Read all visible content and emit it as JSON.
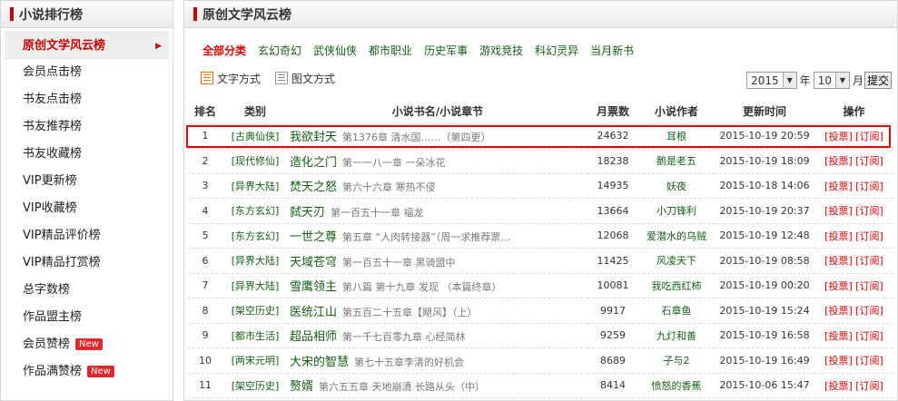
{
  "sidebar": {
    "title": "小说排行榜",
    "items": [
      {
        "label": "原创文学风云榜",
        "active": true
      },
      {
        "label": "会员点击榜"
      },
      {
        "label": "书友点击榜"
      },
      {
        "label": "书友推荐榜"
      },
      {
        "label": "书友收藏榜"
      },
      {
        "label": "VIP更新榜"
      },
      {
        "label": "VIP收藏榜"
      },
      {
        "label": "VIP精品评价榜"
      },
      {
        "label": "VIP精品打赏榜"
      },
      {
        "label": "总字数榜"
      },
      {
        "label": "作品盟主榜"
      },
      {
        "label": "会员赞榜",
        "badge": "New"
      },
      {
        "label": "作品满赞榜",
        "badge": "New"
      }
    ]
  },
  "main": {
    "title": "原创文学风云榜",
    "categories": [
      "全部分类",
      "玄幻奇幻",
      "武侠仙侠",
      "都市职业",
      "历史军事",
      "游戏竞技",
      "科幻灵异",
      "当月新书"
    ],
    "mode_text": "文字方式",
    "mode_image": "图文方式",
    "year": "2015",
    "year_unit": "年",
    "month": "10",
    "month_unit": "月",
    "submit": "提交",
    "headers": [
      "排名",
      "类别",
      "小说书名/小说章节",
      "月票数",
      "小说作者",
      "更新时间",
      "操作"
    ],
    "rows": [
      {
        "rank": "1",
        "type": "[古典仙侠]",
        "title": "我欲封天",
        "chapter": "第1376章 清水国……（第四更）",
        "votes": "24632",
        "author": "耳根",
        "time": "2015-10-19 20:59",
        "vote": "[投票]",
        "sub": "[订阅]"
      },
      {
        "rank": "2",
        "type": "[现代修仙]",
        "title": "造化之门",
        "chapter": "第一一八一章 一朵冰花",
        "votes": "18238",
        "author": "鹅是老五",
        "time": "2015-10-19 18:09",
        "vote": "[投票]",
        "sub": "[订阅]"
      },
      {
        "rank": "3",
        "type": "[异界大陆]",
        "title": "焚天之怒",
        "chapter": "第六十六章 寒热不侵",
        "votes": "14935",
        "author": "妖夜",
        "time": "2015-10-18 14:06",
        "vote": "[投票]",
        "sub": "[订阅]"
      },
      {
        "rank": "4",
        "type": "[东方玄幻]",
        "title": "弑天刃",
        "chapter": "第一百五十一章 福龙",
        "votes": "13664",
        "author": "小刀锋利",
        "time": "2015-10-19 20:37",
        "vote": "[投票]",
        "sub": "[订阅]"
      },
      {
        "rank": "5",
        "type": "[东方玄幻]",
        "title": "一世之尊",
        "chapter": "第五章 “人肉转接器”（周一求推荐票…",
        "votes": "12068",
        "author": "爱潜水的乌贼",
        "time": "2015-10-19 12:48",
        "vote": "[投票]",
        "sub": "[订阅]"
      },
      {
        "rank": "6",
        "type": "[异界大陆]",
        "title": "天域苍穹",
        "chapter": "第一百五十一章 黑骑盟中",
        "votes": "11425",
        "author": "风凌天下",
        "time": "2015-10-19 08:58",
        "vote": "[投票]",
        "sub": "[订阅]"
      },
      {
        "rank": "7",
        "type": "[异界大陆]",
        "title": "雪鹰领主",
        "chapter": "第八篇 第十九章 发现 （本篇终章）",
        "votes": "10081",
        "author": "我吃西红柿",
        "time": "2015-10-19 00:20",
        "vote": "[投票]",
        "sub": "[订阅]"
      },
      {
        "rank": "8",
        "type": "[架空历史]",
        "title": "医统江山",
        "chapter": "第五百二十五章【飓风】（上）",
        "votes": "9917",
        "author": "石章鱼",
        "time": "2015-10-19 15:24",
        "vote": "[投票]",
        "sub": "[订阅]"
      },
      {
        "rank": "9",
        "type": "[都市生活]",
        "title": "超品相师",
        "chapter": "第一千七百零九章 心经简林",
        "votes": "9259",
        "author": "九灯和善",
        "time": "2015-10-19 16:58",
        "vote": "[投票]",
        "sub": "[订阅]"
      },
      {
        "rank": "10",
        "type": "[两宋元明]",
        "title": "大宋的智慧",
        "chapter": "第七十五章李清的好机会",
        "votes": "8689",
        "author": "子与2",
        "time": "2015-10-19 16:49",
        "vote": "[投票]",
        "sub": "[订阅]"
      },
      {
        "rank": "11",
        "type": "[架空历史]",
        "title": "赘婿",
        "chapter": "第六五五章 天地崩潰 长路从头（中）",
        "votes": "8414",
        "author": "愤怒的香蕉",
        "time": "2015-10-06 15:47",
        "vote": "[投票]",
        "sub": "[订阅]"
      }
    ]
  }
}
